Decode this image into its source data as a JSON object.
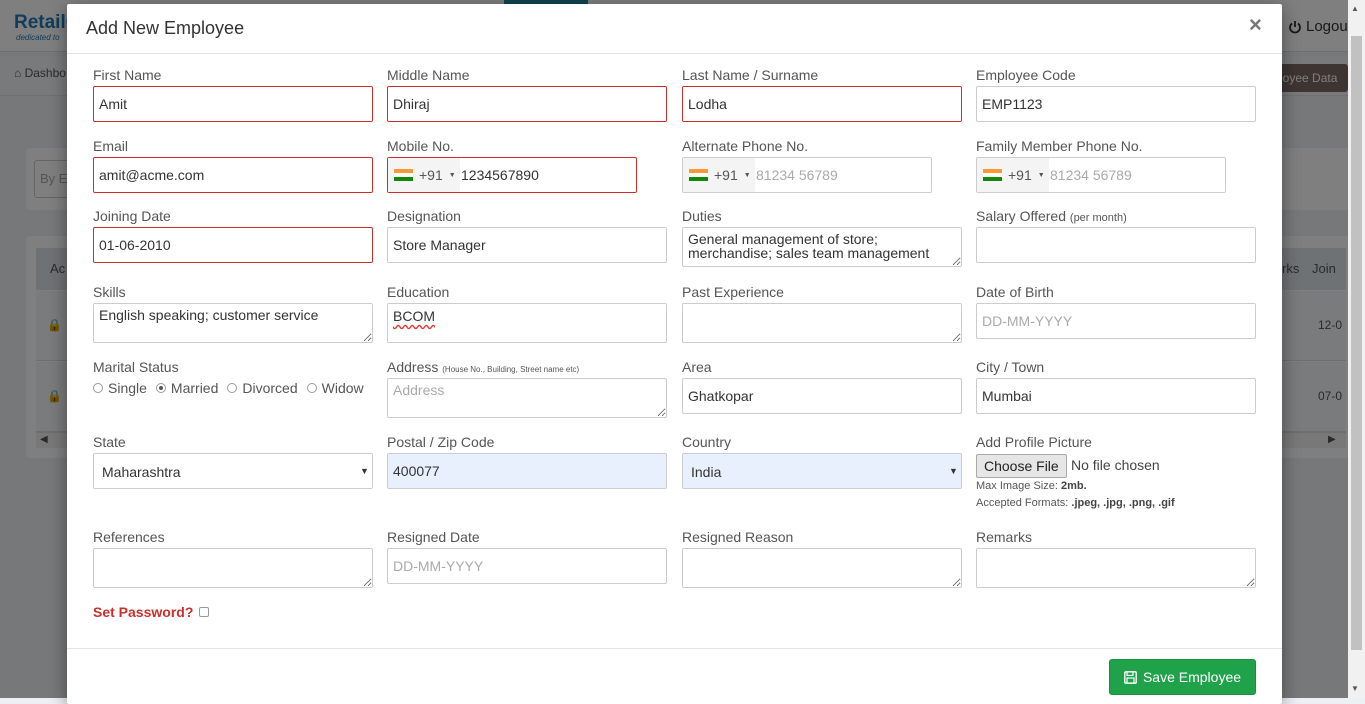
{
  "background": {
    "logo": "RetailC",
    "logo_sub": "dedicated to",
    "logout": "Logout",
    "breadcrumb": "Dashbo",
    "employee_data_btn": "loyee Data",
    "filter_placeholder": "By E",
    "table_head_left": "Ac",
    "table_head_r1": "rks",
    "table_head_r2": "Join",
    "rows": [
      {
        "right": "12-0"
      },
      {
        "right": "07-0"
      }
    ]
  },
  "modal": {
    "title": "Add New Employee",
    "close": "×",
    "save_label": "Save Employee"
  },
  "fields": {
    "first_name": {
      "label": "First Name",
      "value": "Amit"
    },
    "middle_name": {
      "label": "Middle Name",
      "value": "Dhiraj"
    },
    "last_name": {
      "label": "Last Name / Surname",
      "value": "Lodha"
    },
    "employee_code": {
      "label": "Employee Code",
      "value": "EMP1123"
    },
    "email": {
      "label": "Email",
      "value": "amit@acme.com"
    },
    "mobile": {
      "label": "Mobile No.",
      "dial": "+91",
      "value": "1234567890"
    },
    "alt_phone": {
      "label": "Alternate Phone No.",
      "dial": "+91",
      "placeholder": "81234 56789"
    },
    "family_phone": {
      "label": "Family Member Phone No.",
      "dial": "+91",
      "placeholder": "81234 56789"
    },
    "joining_date": {
      "label": "Joining Date",
      "value": "01-06-2010"
    },
    "designation": {
      "label": "Designation",
      "value": "Store Manager"
    },
    "duties": {
      "label": "Duties",
      "value": "General management of store; merchandise; sales team management"
    },
    "salary": {
      "label": "Salary Offered",
      "label_small": "(per month)",
      "value": ""
    },
    "skills": {
      "label": "Skills",
      "value": "English speaking; customer service"
    },
    "education": {
      "label": "Education",
      "value": "BCOM"
    },
    "past_experience": {
      "label": "Past Experience",
      "value": ""
    },
    "dob": {
      "label": "Date of Birth",
      "placeholder": "DD-MM-YYYY"
    },
    "marital": {
      "label": "Marital Status",
      "options": [
        "Single",
        "Married",
        "Divorced",
        "Widow"
      ],
      "selected": "Married"
    },
    "address": {
      "label": "Address",
      "label_small": "(House No., Building, Street name etc)",
      "placeholder": "Address"
    },
    "area": {
      "label": "Area",
      "value": "Ghatkopar"
    },
    "city": {
      "label": "City / Town",
      "value": "Mumbai"
    },
    "state": {
      "label": "State",
      "value": "Maharashtra"
    },
    "postal": {
      "label": "Postal / Zip Code",
      "value": "400077"
    },
    "country": {
      "label": "Country",
      "value": "India"
    },
    "profile_pic": {
      "label": "Add Profile Picture",
      "button": "Choose File",
      "status": "No file chosen",
      "size_label": "Max Image Size:",
      "size_value": "2mb.",
      "formats_label": "Accepted Formats:",
      "formats_value": ".jpeg, .jpg, .png, .gif"
    },
    "references": {
      "label": "References",
      "value": ""
    },
    "resigned_date": {
      "label": "Resigned Date",
      "placeholder": "DD-MM-YYYY"
    },
    "resigned_reason": {
      "label": "Resigned Reason",
      "value": ""
    },
    "remarks": {
      "label": "Remarks",
      "value": ""
    },
    "set_password": {
      "label": "Set Password?"
    }
  },
  "colors": {
    "error_border": "#c9302c",
    "autofill_bg": "#e8f0fe",
    "save_button": "#1fa24a"
  },
  "icons": {
    "close": "close-icon",
    "save": "floppy-disk-icon",
    "flag": "india-flag-icon",
    "logout": "power-icon"
  }
}
